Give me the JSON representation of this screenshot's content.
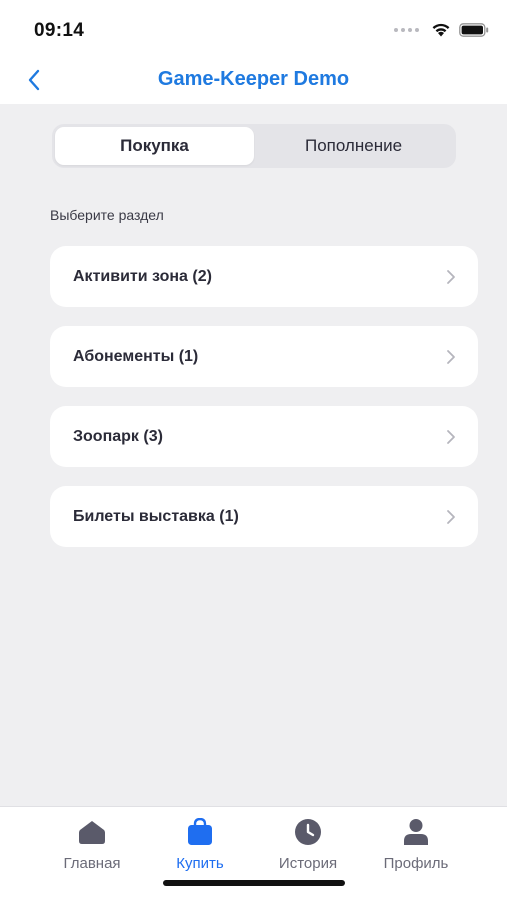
{
  "status_bar": {
    "time": "09:14"
  },
  "nav": {
    "title": "Game-Keeper Demo",
    "back_icon": "chevron-left-icon"
  },
  "segments": [
    {
      "label": "Покупка",
      "active": true
    },
    {
      "label": "Пополнение",
      "active": false
    }
  ],
  "section_label": "Выберите раздел",
  "list": [
    {
      "label": "Активити зона (2)"
    },
    {
      "label": "Абонементы (1)"
    },
    {
      "label": "Зоопарк (3)"
    },
    {
      "label": "Билеты выставка (1)"
    }
  ],
  "tabs": [
    {
      "label": "Главная",
      "icon": "home-icon",
      "active": false
    },
    {
      "label": "Купить",
      "icon": "shopping-bag-icon",
      "active": true
    },
    {
      "label": "История",
      "icon": "clock-icon",
      "active": false
    },
    {
      "label": "Профиль",
      "icon": "person-icon",
      "active": false
    }
  ],
  "colors": {
    "accent": "#1f7ae0",
    "active_tab": "#1f6ef0",
    "inactive_tab": "#5a5a6a",
    "background": "#efeff1"
  }
}
